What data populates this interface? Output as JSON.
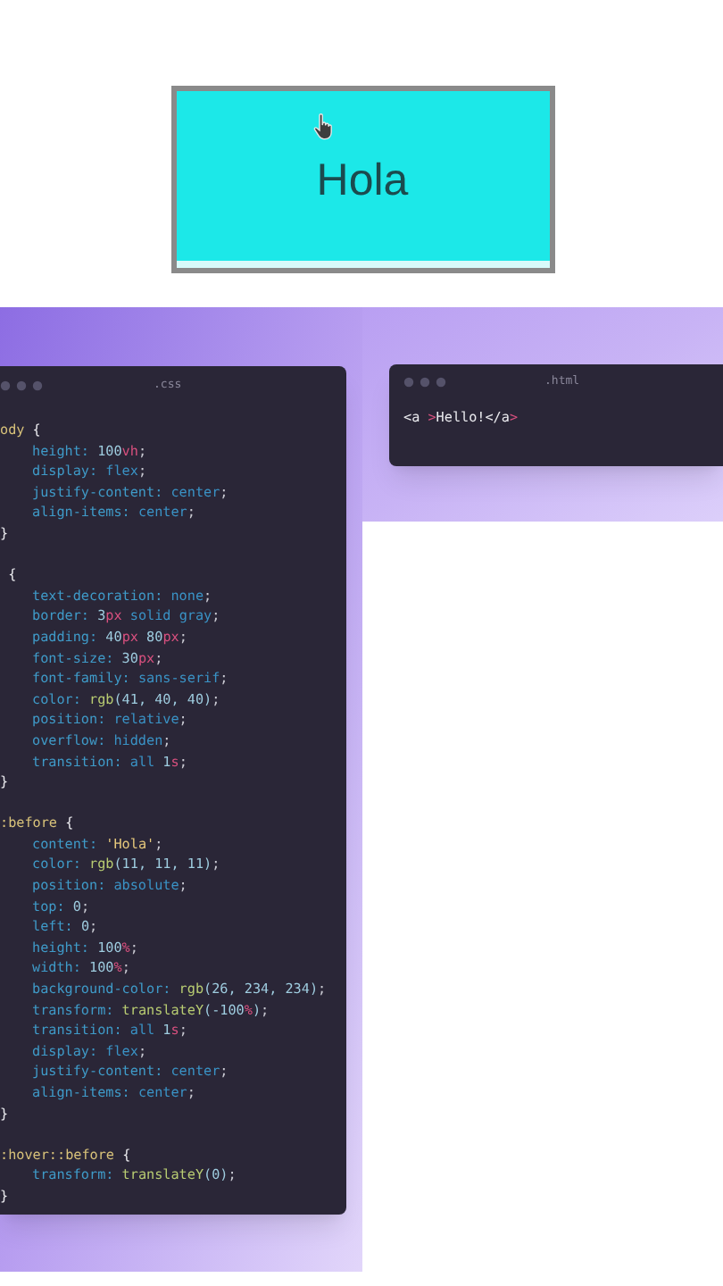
{
  "demo_button": {
    "label": "Hola"
  },
  "css_window": {
    "title": ".css",
    "lines": [
      {
        "kind": "selector",
        "tokens": [
          {
            "text": "ody ",
            "kind": "sel"
          },
          {
            "text": "{",
            "kind": "brace"
          }
        ]
      },
      {
        "kind": "decl",
        "tokens": [
          {
            "text": "height: ",
            "kind": "prop"
          },
          {
            "text": "100",
            "kind": "num"
          },
          {
            "text": "vh",
            "kind": "unit"
          },
          {
            "text": ";",
            "kind": "punct"
          }
        ]
      },
      {
        "kind": "decl",
        "tokens": [
          {
            "text": "display: ",
            "kind": "prop"
          },
          {
            "text": "flex",
            "kind": "val"
          },
          {
            "text": ";",
            "kind": "punct"
          }
        ]
      },
      {
        "kind": "decl",
        "tokens": [
          {
            "text": "justify-content: ",
            "kind": "prop"
          },
          {
            "text": "center",
            "kind": "val"
          },
          {
            "text": ";",
            "kind": "punct"
          }
        ]
      },
      {
        "kind": "decl",
        "tokens": [
          {
            "text": "align-items: ",
            "kind": "prop"
          },
          {
            "text": "center",
            "kind": "val"
          },
          {
            "text": ";",
            "kind": "punct"
          }
        ]
      },
      {
        "kind": "close",
        "tokens": [
          {
            "text": "}",
            "kind": "brace"
          }
        ]
      },
      {
        "kind": "blank"
      },
      {
        "kind": "selector",
        "tokens": [
          {
            "text": " {",
            "kind": "brace"
          }
        ]
      },
      {
        "kind": "decl",
        "tokens": [
          {
            "text": "text-decoration: ",
            "kind": "prop"
          },
          {
            "text": "none",
            "kind": "val"
          },
          {
            "text": ";",
            "kind": "punct"
          }
        ]
      },
      {
        "kind": "decl",
        "tokens": [
          {
            "text": "border: ",
            "kind": "prop"
          },
          {
            "text": "3",
            "kind": "num"
          },
          {
            "text": "px",
            "kind": "unit"
          },
          {
            "text": " solid gray",
            "kind": "val"
          },
          {
            "text": ";",
            "kind": "punct"
          }
        ]
      },
      {
        "kind": "decl",
        "tokens": [
          {
            "text": "padding: ",
            "kind": "prop"
          },
          {
            "text": "40",
            "kind": "num"
          },
          {
            "text": "px",
            "kind": "unit"
          },
          {
            "text": " 80",
            "kind": "num"
          },
          {
            "text": "px",
            "kind": "unit"
          },
          {
            "text": ";",
            "kind": "punct"
          }
        ]
      },
      {
        "kind": "decl",
        "tokens": [
          {
            "text": "font-size: ",
            "kind": "prop"
          },
          {
            "text": "30",
            "kind": "num"
          },
          {
            "text": "px",
            "kind": "unit"
          },
          {
            "text": ";",
            "kind": "punct"
          }
        ]
      },
      {
        "kind": "decl",
        "tokens": [
          {
            "text": "font-family: ",
            "kind": "prop"
          },
          {
            "text": "sans-serif",
            "kind": "val"
          },
          {
            "text": ";",
            "kind": "punct"
          }
        ]
      },
      {
        "kind": "decl",
        "tokens": [
          {
            "text": "color: ",
            "kind": "prop"
          },
          {
            "text": "rgb",
            "kind": "fn"
          },
          {
            "text": "(41, 40, 40)",
            "kind": "num"
          },
          {
            "text": ";",
            "kind": "punct"
          }
        ]
      },
      {
        "kind": "decl",
        "tokens": [
          {
            "text": "position: ",
            "kind": "prop"
          },
          {
            "text": "relative",
            "kind": "val"
          },
          {
            "text": ";",
            "kind": "punct"
          }
        ]
      },
      {
        "kind": "decl",
        "tokens": [
          {
            "text": "overflow: ",
            "kind": "prop"
          },
          {
            "text": "hidden",
            "kind": "val"
          },
          {
            "text": ";",
            "kind": "punct"
          }
        ]
      },
      {
        "kind": "decl",
        "tokens": [
          {
            "text": "transition: ",
            "kind": "prop"
          },
          {
            "text": "all ",
            "kind": "val"
          },
          {
            "text": "1",
            "kind": "num"
          },
          {
            "text": "s",
            "kind": "unit"
          },
          {
            "text": ";",
            "kind": "punct"
          }
        ]
      },
      {
        "kind": "close",
        "tokens": [
          {
            "text": "}",
            "kind": "brace"
          }
        ]
      },
      {
        "kind": "blank"
      },
      {
        "kind": "selector",
        "tokens": [
          {
            "text": ":before ",
            "kind": "sel"
          },
          {
            "text": "{",
            "kind": "brace"
          }
        ]
      },
      {
        "kind": "decl",
        "tokens": [
          {
            "text": "content: ",
            "kind": "prop"
          },
          {
            "text": "'Hola'",
            "kind": "str"
          },
          {
            "text": ";",
            "kind": "punct"
          }
        ]
      },
      {
        "kind": "decl",
        "tokens": [
          {
            "text": "color: ",
            "kind": "prop"
          },
          {
            "text": "rgb",
            "kind": "fn"
          },
          {
            "text": "(11, 11, 11)",
            "kind": "num"
          },
          {
            "text": ";",
            "kind": "punct"
          }
        ]
      },
      {
        "kind": "decl",
        "tokens": [
          {
            "text": "position: ",
            "kind": "prop"
          },
          {
            "text": "absolute",
            "kind": "val"
          },
          {
            "text": ";",
            "kind": "punct"
          }
        ]
      },
      {
        "kind": "decl",
        "tokens": [
          {
            "text": "top: ",
            "kind": "prop"
          },
          {
            "text": "0",
            "kind": "num"
          },
          {
            "text": ";",
            "kind": "punct"
          }
        ]
      },
      {
        "kind": "decl",
        "tokens": [
          {
            "text": "left: ",
            "kind": "prop"
          },
          {
            "text": "0",
            "kind": "num"
          },
          {
            "text": ";",
            "kind": "punct"
          }
        ]
      },
      {
        "kind": "decl",
        "tokens": [
          {
            "text": "height: ",
            "kind": "prop"
          },
          {
            "text": "100",
            "kind": "num"
          },
          {
            "text": "%",
            "kind": "unit"
          },
          {
            "text": ";",
            "kind": "punct"
          }
        ]
      },
      {
        "kind": "decl",
        "tokens": [
          {
            "text": "width: ",
            "kind": "prop"
          },
          {
            "text": "100",
            "kind": "num"
          },
          {
            "text": "%",
            "kind": "unit"
          },
          {
            "text": ";",
            "kind": "punct"
          }
        ]
      },
      {
        "kind": "decl",
        "tokens": [
          {
            "text": "background-color: ",
            "kind": "prop"
          },
          {
            "text": "rgb",
            "kind": "fn"
          },
          {
            "text": "(26, 234, 234)",
            "kind": "num"
          },
          {
            "text": ";",
            "kind": "punct"
          }
        ]
      },
      {
        "kind": "decl",
        "tokens": [
          {
            "text": "transform: ",
            "kind": "prop"
          },
          {
            "text": "translateY",
            "kind": "fn"
          },
          {
            "text": "(-100",
            "kind": "num"
          },
          {
            "text": "%",
            "kind": "unit"
          },
          {
            "text": ")",
            "kind": "num"
          },
          {
            "text": ";",
            "kind": "punct"
          }
        ]
      },
      {
        "kind": "decl",
        "tokens": [
          {
            "text": "transition: ",
            "kind": "prop"
          },
          {
            "text": "all ",
            "kind": "val"
          },
          {
            "text": "1",
            "kind": "num"
          },
          {
            "text": "s",
            "kind": "unit"
          },
          {
            "text": ";",
            "kind": "punct"
          }
        ]
      },
      {
        "kind": "decl",
        "tokens": [
          {
            "text": "display: ",
            "kind": "prop"
          },
          {
            "text": "flex",
            "kind": "val"
          },
          {
            "text": ";",
            "kind": "punct"
          }
        ]
      },
      {
        "kind": "decl",
        "tokens": [
          {
            "text": "justify-content: ",
            "kind": "prop"
          },
          {
            "text": "center",
            "kind": "val"
          },
          {
            "text": ";",
            "kind": "punct"
          }
        ]
      },
      {
        "kind": "decl",
        "tokens": [
          {
            "text": "align-items: ",
            "kind": "prop"
          },
          {
            "text": "center",
            "kind": "val"
          },
          {
            "text": ";",
            "kind": "punct"
          }
        ]
      },
      {
        "kind": "close",
        "tokens": [
          {
            "text": "}",
            "kind": "brace"
          }
        ]
      },
      {
        "kind": "blank"
      },
      {
        "kind": "selector",
        "tokens": [
          {
            "text": ":hover::before ",
            "kind": "sel"
          },
          {
            "text": "{",
            "kind": "brace"
          }
        ]
      },
      {
        "kind": "decl",
        "tokens": [
          {
            "text": "transform: ",
            "kind": "prop"
          },
          {
            "text": "translateY",
            "kind": "fn"
          },
          {
            "text": "(0)",
            "kind": "num"
          },
          {
            "text": ";",
            "kind": "punct"
          }
        ]
      },
      {
        "kind": "close",
        "tokens": [
          {
            "text": "}",
            "kind": "brace"
          }
        ]
      }
    ]
  },
  "html_window": {
    "title": ".html",
    "lines": [
      {
        "kind": "code",
        "tokens": [
          {
            "text": "<a ",
            "kind": "tag"
          },
          {
            "text": ">",
            "kind": "unit"
          },
          {
            "text": "Hello!",
            "kind": "tag"
          },
          {
            "text": "</a",
            "kind": "tag"
          },
          {
            "text": ">",
            "kind": "unit"
          }
        ]
      }
    ]
  }
}
